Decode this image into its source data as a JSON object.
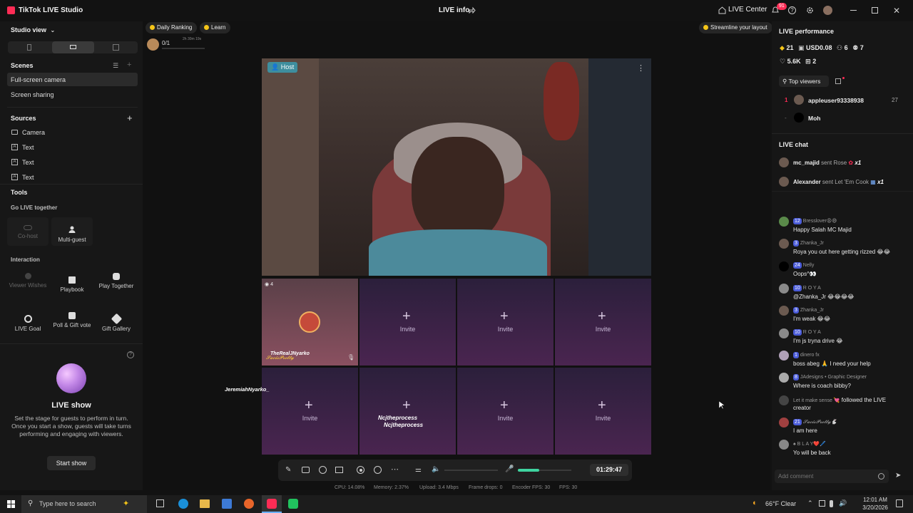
{
  "app": {
    "title": "TikTok LIVE Studio",
    "center_title": "LIVE info"
  },
  "titlebar": {
    "live_center": "LIVE Center",
    "notif_count": "91"
  },
  "left": {
    "studio_view": "Studio view",
    "scenes_header": "Scenes",
    "scenes": [
      "Full-screen camera",
      "Screen sharing"
    ],
    "sources_header": "Sources",
    "sources": [
      "Camera",
      "Text",
      "Text",
      "Text"
    ],
    "tools_header": "Tools",
    "go_live_together": "Go LIVE together",
    "cohost": "Co-host",
    "multiguest": "Multi-guest",
    "interaction": "Interaction",
    "viewer_wishes": "Viewer Wishes",
    "playbook": "Playbook",
    "play_together": "Play Together",
    "live_goal": "LIVE Goal",
    "poll_gift": "Poll & Gift vote",
    "gift_gallery": "Gift Gallery",
    "live_show_title": "LIVE show",
    "live_show_desc": "Set the stage for guests to perform in turn. Once you start a show, guests will take turns performing and engaging with viewers.",
    "start_show": "Start show"
  },
  "center": {
    "daily_ranking": "Daily Ranking",
    "learn": "Learn",
    "progress": "0/1",
    "progress_time": "2h 30m 19s",
    "streamline": "Streamline your layout",
    "host_label": "Host",
    "guest_count": "4",
    "guest_name": "TheRealJNyarko",
    "guest_tag": "𝓢𝓪𝓬𝓲𝓼𝓟𝓻𝓮𝓽𝓽𝔂",
    "side_user": "JeremiahNyarko_",
    "invite": "Invite",
    "process_1": "Ncjtheprocess",
    "process_2": "Ncjtheprocess",
    "timer": "01:29:47",
    "stats": {
      "cpu": "CPU: 14.08%",
      "memory": "Memory: 2.37%",
      "upload": "Upload: 3.4 Mbps",
      "drops": "Frame drops: 0",
      "encoder": "Encoder FPS: 30",
      "fps": "FPS: 30"
    },
    "volume_level": 0.4
  },
  "right": {
    "perf_title": "LIVE performance",
    "coins": "21",
    "usd": "USD0.08",
    "viewers": "6",
    "followers": "7",
    "likes": "5.6K",
    "gifts": "2",
    "top_viewers": "Top viewers",
    "top": [
      {
        "rank": "1",
        "name": "appleuser93338938",
        "score": "27"
      },
      {
        "rank": "-",
        "name": "Moh",
        "score": ""
      }
    ],
    "chat_title": "LIVE chat",
    "gift_events": [
      {
        "user": "mc_majid",
        "text": "sent Rose",
        "count": "x1"
      },
      {
        "user": "Alexander",
        "text": "sent Let 'Em Cook",
        "count": "x1"
      }
    ],
    "messages": [
      {
        "lvl": "12",
        "user": "Bresslover😩😄",
        "text": "Happy Salah MC Majid"
      },
      {
        "lvl": "3",
        "user": "Zhanka_Jr",
        "text": "Roya you out here getting rizzed 😂😂"
      },
      {
        "lvl": "24",
        "user": "Nelly",
        "text": "Oops^👀"
      },
      {
        "lvl": "10",
        "user": "R O Y A",
        "text": "@Zhanka_Jr 😂😂😂😂"
      },
      {
        "lvl": "3",
        "user": "Zhanka_Jr",
        "text": "I'm weak 😂😂"
      },
      {
        "lvl": "10",
        "user": "R O Y A",
        "text": "I'm js tryna drive 😂"
      },
      {
        "lvl": "1",
        "user": "dinero fx",
        "text": "boss abeg 🙏 I need your help"
      },
      {
        "lvl": "8",
        "user": "JAdesigns • Graphic Designer",
        "text": "Where is coach bibby?"
      },
      {
        "lvl": "",
        "user": "Let it make sense 💘",
        "text": "followed the LIVE creator"
      },
      {
        "lvl": "21",
        "user": "𝓢𝓪𝓬𝓲𝓼𝓟𝓻𝓮𝓽𝓽𝔂🐇",
        "text": "I am here"
      },
      {
        "lvl": "",
        "user": "♠ B L A Y❤️🖊️",
        "text": "Yo will be back"
      }
    ],
    "comment_placeholder": "Add comment"
  },
  "taskbar": {
    "search_placeholder": "Type here to search",
    "weather": "66°F  Clear",
    "time": "12:01 AM",
    "date": "3/20/2026"
  },
  "colors": {
    "accent": "#fe2c55",
    "lvl": "#4a5bd8",
    "host_badge": "#3e8e9e",
    "invite_cell": "#3a2248"
  }
}
